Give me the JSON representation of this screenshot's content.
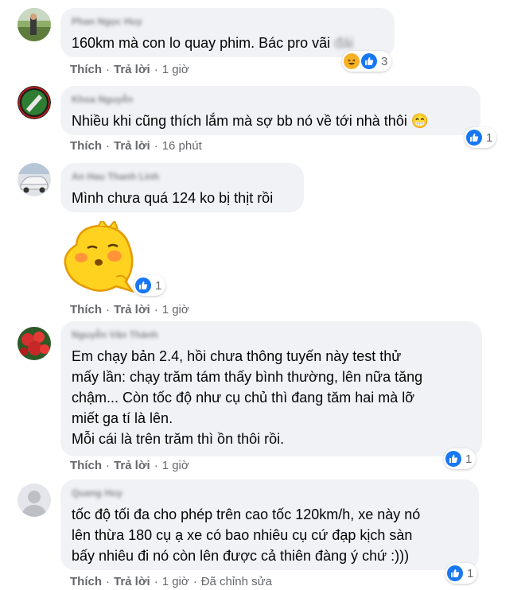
{
  "comments": [
    {
      "author": "Phan Ngọc Huy",
      "text": "160km mà con lo quay phim. Bác pro vãi",
      "text_extra": "đái",
      "like_label": "Thích",
      "reply_label": "Trả lời",
      "time": "1 giờ",
      "reaction_icons": [
        "haha-icon",
        "like-icon"
      ],
      "reaction_count": "3"
    },
    {
      "author": "Khoa Nguyễn",
      "text": "Nhiều khi cũng thích lắm mà sợ bb nó về tới nhà thôi 😁",
      "like_label": "Thích",
      "reply_label": "Trả lời",
      "time": "16 phút",
      "reaction_icons": [
        "like-icon"
      ],
      "reaction_count": "1"
    },
    {
      "author": "An Hau Thanh Linh",
      "text": "Mình chưa quá 124 ko bị thịt rồi",
      "sticker": "yellow-dinosaur-sticker",
      "like_label": "Thích",
      "reply_label": "Trả lời",
      "time": "1 giờ",
      "reaction_icons": [
        "like-icon"
      ],
      "reaction_count": "1"
    },
    {
      "author": "Nguyễn Văn Thành",
      "text": "Em chạy bản 2.4, hồi chưa thông tuyến này test thử\nmấy lần: chạy trăm tám thấy bình thường, lên nữa tăng\nchậm... Còn tốc độ như cụ chủ thì đang tăm hai mà lỡ\nmiết ga tí là lên.\nMỗi cái là trên trăm thì ồn thôi rồi.",
      "like_label": "Thích",
      "reply_label": "Trả lời",
      "time": "1 giờ",
      "reaction_icons": [
        "like-icon"
      ],
      "reaction_count": "1"
    },
    {
      "author": "Quang Huy",
      "text": "tốc độ tối đa cho phép trên cao tốc 120km/h, xe này nó\nlên thừa 180 cụ ạ xe có bao nhiêu cụ cứ đạp kịch sàn\nbấy nhiêu đi nó còn lên được cả thiên đàng ý chứ :)))",
      "like_label": "Thích",
      "reply_label": "Trả lời",
      "time": "1 giờ",
      "edited_label": "Đã chỉnh sửa",
      "reaction_icons": [
        "like-icon"
      ],
      "reaction_count": "1"
    }
  ],
  "colors": {
    "bubble": "#f0f2f5",
    "meta_text": "#65676b",
    "like_blue": "#1877f2",
    "haha_yellow": "#f7b125"
  }
}
